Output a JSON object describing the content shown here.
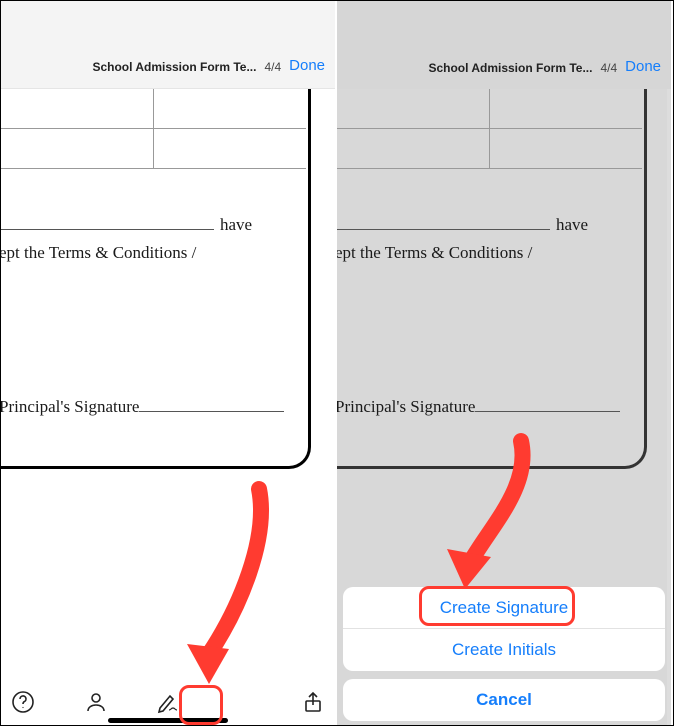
{
  "left": {
    "header": {
      "title": "School Admission Form Te...",
      "page_indicator": "4/4",
      "done": "Done"
    },
    "doc": {
      "have": "have",
      "terms_line": "ept the Terms & Conditions /",
      "sig_label": "Principal's Signature"
    }
  },
  "right": {
    "header": {
      "title": "School Admission Form Te...",
      "page_indicator": "4/4",
      "done": "Done"
    },
    "doc": {
      "have": "have",
      "terms_line": "ept the Terms & Conditions /",
      "sig_label": "Principal's Signature"
    },
    "sheet": {
      "create_signature": "Create Signature",
      "create_initials": "Create Initials",
      "cancel": "Cancel"
    }
  }
}
